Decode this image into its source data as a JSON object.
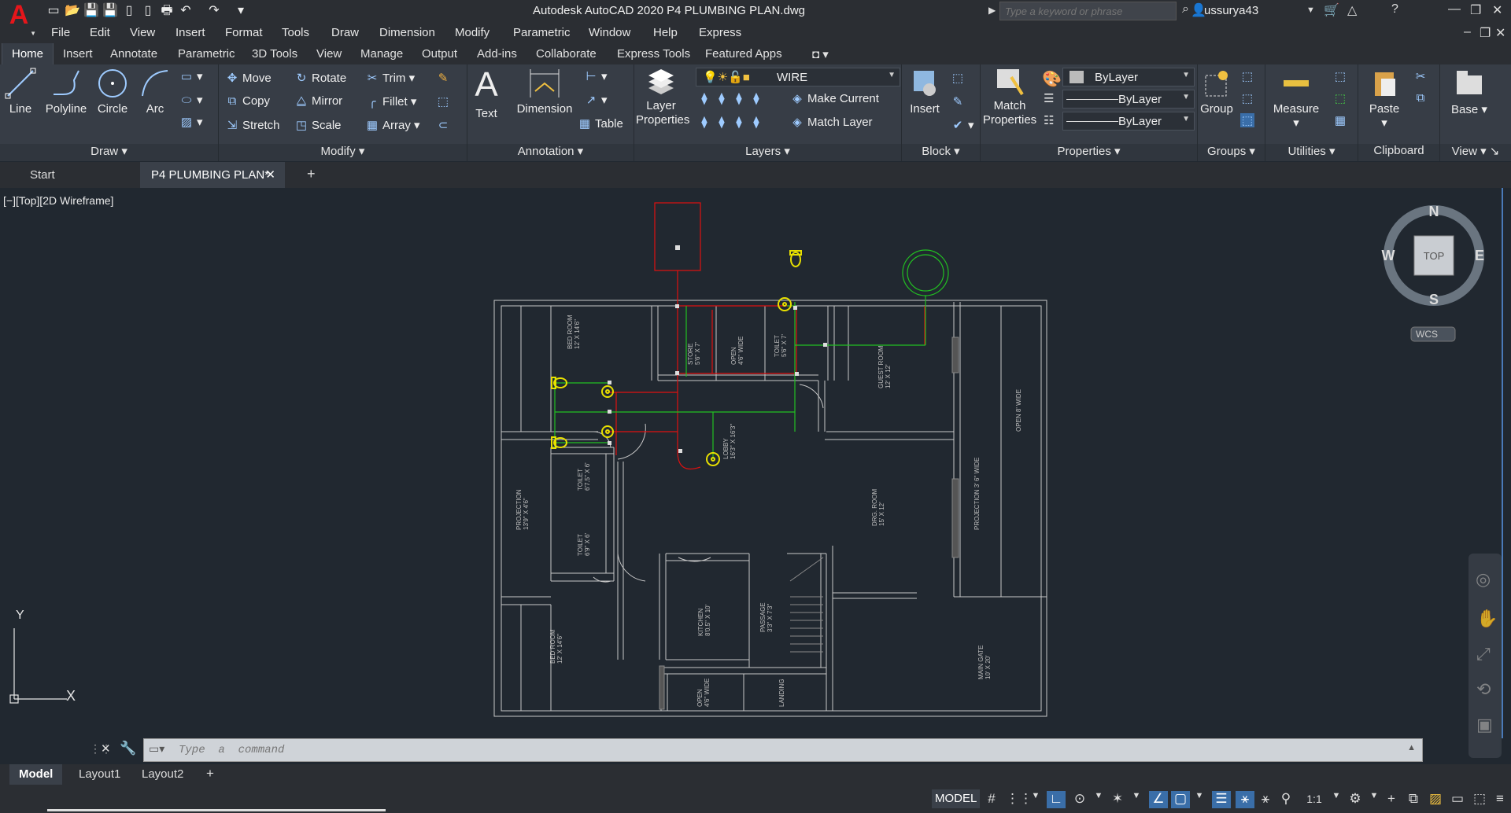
{
  "app": {
    "title": "Autodesk AutoCAD 2020   P4 PLUMBING PLAN.dwg",
    "logo": "A",
    "search_placeholder": "Type a keyword or phrase",
    "user": "ussurya43"
  },
  "menu": [
    "File",
    "Edit",
    "View",
    "Insert",
    "Format",
    "Tools",
    "Draw",
    "Dimension",
    "Modify",
    "Parametric",
    "Window",
    "Help",
    "Express"
  ],
  "ribbon_tabs": [
    "Home",
    "Insert",
    "Annotate",
    "Parametric",
    "3D Tools",
    "View",
    "Manage",
    "Output",
    "Add-ins",
    "Collaborate",
    "Express Tools",
    "Featured Apps"
  ],
  "panels": {
    "draw": {
      "title": "Draw",
      "line": "Line",
      "polyline": "Polyline",
      "circle": "Circle",
      "arc": "Arc"
    },
    "modify": {
      "title": "Modify",
      "move": "Move",
      "rotate": "Rotate",
      "trim": "Trim",
      "copy": "Copy",
      "mirror": "Mirror",
      "fillet": "Fillet",
      "stretch": "Stretch",
      "scale": "Scale",
      "array": "Array"
    },
    "annotation": {
      "title": "Annotation",
      "text": "Text",
      "dimension": "Dimension",
      "table": "Table"
    },
    "layers": {
      "title": "Layers",
      "layer_properties": "Layer\nProperties",
      "current_layer": "WIRE",
      "make_current": "Make Current",
      "match_layer": "Match Layer"
    },
    "block": {
      "title": "Block",
      "insert": "Insert"
    },
    "properties": {
      "title": "Properties",
      "match_properties": "Match\nProperties",
      "color": "ByLayer",
      "linetype": "ByLayer",
      "lineweight": "ByLayer"
    },
    "groups": {
      "title": "Groups",
      "group": "Group"
    },
    "utilities": {
      "title": "Utilities",
      "measure": "Measure"
    },
    "clipboard": {
      "title": "Clipboard",
      "paste": "Paste"
    },
    "view": {
      "title": "View",
      "base": "Base"
    }
  },
  "doc_tabs": [
    "Start",
    "P4 PLUMBING PLAN*"
  ],
  "viewport": {
    "label": "[−][Top][2D Wireframe]",
    "viewcube": {
      "n": "N",
      "s": "S",
      "e": "E",
      "w": "W",
      "face": "TOP",
      "ucs": "WCS"
    },
    "ucs_icon": {
      "x": "X",
      "y": "Y"
    }
  },
  "plan_labels": {
    "bed1": [
      "BED ROOM",
      "12' X 14'6\""
    ],
    "store": [
      "STORE",
      "5'6\" X 7'"
    ],
    "open1": [
      "OPEN",
      "4'6\" WIDE"
    ],
    "toilet1": [
      "TOILET",
      "5'6\" X 7'"
    ],
    "guest": [
      "GUEST ROOM",
      "12' X 12'"
    ],
    "open8": [
      "OPEN 8' WIDE"
    ],
    "lobby": [
      "LOBBY",
      "16'3\" X 16'3\""
    ],
    "projection": [
      "PROJECTION",
      "13'9\" X 4'6\""
    ],
    "toilet2": [
      "TOILET",
      "6'7.5\" X 6'"
    ],
    "toilet3": [
      "TOILET",
      "6'9\" X 6'"
    ],
    "drg": [
      "DRG. ROOM",
      "15' X 12'"
    ],
    "projection3": [
      "PROJECTION 3' 6\" WIDE"
    ],
    "bed2": [
      "BED ROOM",
      "12' X 14'6\""
    ],
    "kitchen": [
      "KITCHEN",
      "8'0.5\" X 10'"
    ],
    "passage": [
      "PASSAGE",
      "3'3\" X 7'3\""
    ],
    "maingate": [
      "MAIN GATE",
      "10' X 20'"
    ],
    "open2": [
      "OPEN",
      "4'6\" WIDE"
    ],
    "landing": [
      "LANDING"
    ]
  },
  "command": {
    "placeholder": "Type  a  command"
  },
  "layout_tabs": [
    "Model",
    "Layout1",
    "Layout2"
  ],
  "status": {
    "model": "MODEL",
    "scale": "1:1"
  },
  "colors": {
    "wire_red": "#e01010",
    "wire_green": "#22c022",
    "fixture": "#e8e000",
    "walls": "#c8c8c8",
    "background": "#212830"
  }
}
